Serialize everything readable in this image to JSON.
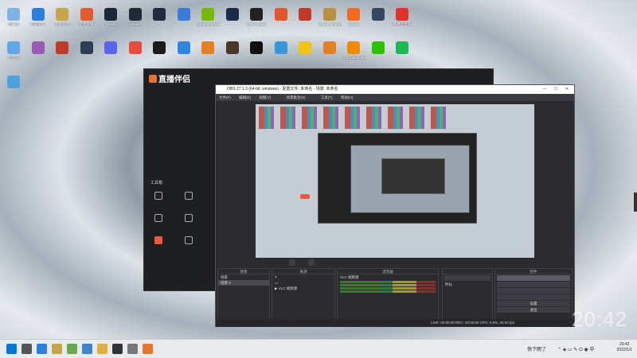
{
  "desktop": {
    "row1": [
      {
        "label": "回收站",
        "icon": "recycle-bin-icon",
        "color": "#7fb2e5"
      },
      {
        "label": "电脑管家",
        "icon": "shield-icon",
        "color": "#2a7fe0"
      },
      {
        "label": "英雄联盟",
        "icon": "lol-icon",
        "color": "#c8a54a"
      },
      {
        "label": "王者荣耀",
        "icon": "game-icon",
        "color": "#e35a2d"
      },
      {
        "label": "Steam",
        "icon": "steam-icon",
        "color": "#1b2838"
      },
      {
        "label": "steam",
        "icon": "steam-icon",
        "color": "#222b35"
      },
      {
        "label": "",
        "icon": "tool-icon",
        "color": "#1f2a3a"
      },
      {
        "label": "",
        "icon": "app-icon",
        "color": "#3a7bd5"
      },
      {
        "label": "GeForce Experience",
        "icon": "nvidia-icon",
        "color": "#76b900"
      },
      {
        "label": "",
        "icon": "app-icon",
        "color": "#1c2a4a"
      },
      {
        "label": "OBS Studio",
        "icon": "obs-icon",
        "color": "#222"
      },
      {
        "label": "",
        "icon": "game-icon",
        "color": "#e2562a"
      },
      {
        "label": "",
        "icon": "game-icon",
        "color": "#c0392b"
      },
      {
        "label": "League of Legends",
        "icon": "lol-icon",
        "color": "#b8913c"
      },
      {
        "label": "Origin",
        "icon": "origin-icon",
        "color": "#f36b21"
      },
      {
        "label": "",
        "icon": "game-icon",
        "color": "#34495e"
      },
      {
        "label": "网易云音乐",
        "icon": "music-icon",
        "color": "#e0312c"
      }
    ],
    "row2": [
      {
        "label": "此电脑",
        "icon": "pc-icon",
        "color": "#5fa8e8"
      },
      {
        "label": "",
        "icon": "app-icon",
        "color": "#9b59b6"
      },
      {
        "label": "",
        "icon": "game-icon",
        "color": "#c0392b"
      },
      {
        "label": "",
        "icon": "game-icon",
        "color": "#2c3e50"
      },
      {
        "label": "",
        "icon": "chat-icon",
        "color": "#5865f2"
      },
      {
        "label": "",
        "icon": "game-icon",
        "color": "#e74c3c"
      },
      {
        "label": "",
        "icon": "app-icon",
        "color": "#1a1a1a"
      },
      {
        "label": "",
        "icon": "cloud-icon",
        "color": "#2e86de"
      },
      {
        "label": "",
        "icon": "game-icon",
        "color": "#e67e22"
      },
      {
        "label": "",
        "icon": "game-icon",
        "color": "#4a3728"
      },
      {
        "label": "",
        "icon": "qq-icon",
        "color": "#111"
      },
      {
        "label": "",
        "icon": "app-icon",
        "color": "#3498db"
      },
      {
        "label": "",
        "icon": "app-icon",
        "color": "#f1c40f"
      },
      {
        "label": "",
        "icon": "app-icon",
        "color": "#e67e22"
      },
      {
        "label": "VLC media player",
        "icon": "vlc-icon",
        "color": "#f08a00"
      },
      {
        "label": "",
        "icon": "wechat-icon",
        "color": "#2dc100"
      },
      {
        "label": "",
        "icon": "music-icon",
        "color": "#1db954"
      }
    ],
    "row3": [
      {
        "label": "",
        "icon": "monitor-icon",
        "color": "#4aa3df"
      }
    ]
  },
  "zbb": {
    "brand": "直播伴侣",
    "tabs": [
      "",
      "",
      ""
    ],
    "empty_text": "",
    "tools_title": "工具箱",
    "tools": [
      {
        "label": "",
        "icon": "tool-icon"
      },
      {
        "label": "",
        "icon": "tool-icon"
      },
      {
        "label": "",
        "icon": "tool-icon"
      },
      {
        "label": "",
        "icon": "download-icon"
      },
      {
        "label": "",
        "icon": "download-icon"
      },
      {
        "label": "",
        "icon": "tool-icon"
      },
      {
        "label": "",
        "icon": "live-icon",
        "highlight": true
      },
      {
        "label": "",
        "icon": "tool-icon"
      },
      {
        "label": "",
        "icon": "tool-icon"
      }
    ],
    "status": ""
  },
  "obs": {
    "title": "OBS 27.1.3 (64-bit, windows) - 配置文件: 未命名 - 场景: 未命名",
    "menu": [
      "文件(F)",
      "编辑(E)",
      "视图(V)",
      "",
      "场景集合(S)",
      "",
      "工具(T)",
      "帮助(H)"
    ],
    "toast": "",
    "scene_label": "",
    "scenebar_buttons": [
      "",
      ""
    ],
    "scenes_header": "场景",
    "scenes": [
      "场景",
      "场景 2"
    ],
    "sources_header": "来源",
    "sources": [
      "",
      "",
      "VLC 视频源"
    ],
    "mixer_header": "混音器",
    "mixer_tracks": [
      "VLC 视频源",
      "",
      ""
    ],
    "transitions_header": "",
    "transition_type": "",
    "duration_label": "时长",
    "duration_value": "",
    "controls_header": "控件",
    "controls": [
      "",
      "",
      "",
      "",
      "设置",
      "退出"
    ],
    "status": "LIVE: 00:00:00   REC: 00:00:00   CPU: 0.8%, 30.00 fps"
  },
  "clock_big": "20:42",
  "taskbar": {
    "tray_text": "快下雨了",
    "time": "20:42",
    "date": "2022/1/1",
    "apps": [
      {
        "icon": "start-icon",
        "color": "#0078d7"
      },
      {
        "icon": "search-icon",
        "color": "#555"
      },
      {
        "icon": "shield-icon",
        "color": "#2a7fe0"
      },
      {
        "icon": "lol-icon",
        "color": "#c8a54a"
      },
      {
        "icon": "app-icon",
        "color": "#6aa84f"
      },
      {
        "icon": "app-icon",
        "color": "#3d85c6"
      },
      {
        "icon": "folder-icon",
        "color": "#e0b040"
      },
      {
        "icon": "obs-icon",
        "color": "#333"
      },
      {
        "icon": "app-icon",
        "color": "#777"
      },
      {
        "icon": "zbb-icon",
        "color": "#e8732c"
      }
    ]
  }
}
